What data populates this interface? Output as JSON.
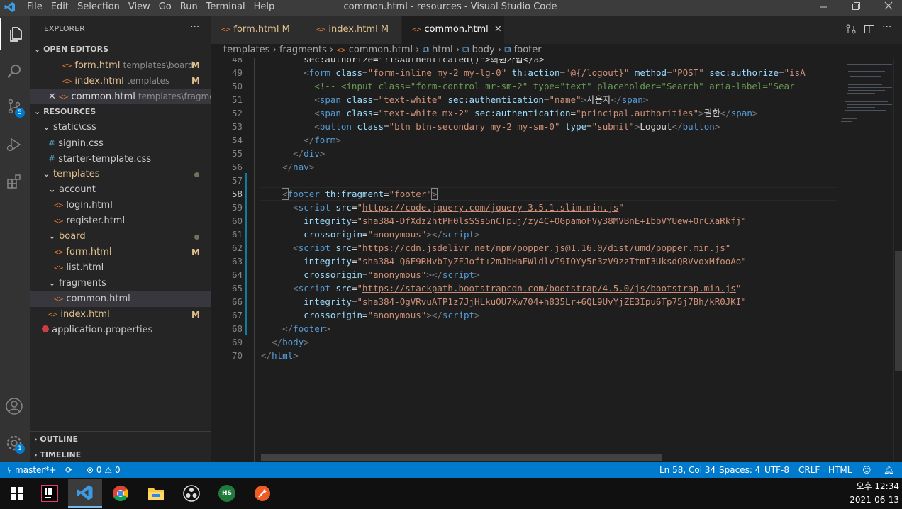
{
  "window": {
    "title": "common.html - resources - Visual Studio Code",
    "menu": [
      "File",
      "Edit",
      "Selection",
      "View",
      "Go",
      "Run",
      "Terminal",
      "Help"
    ]
  },
  "activity": {
    "scm_badge": "5",
    "settings_badge": "1"
  },
  "sidebar": {
    "title": "EXPLORER",
    "open_editors_header": "OPEN EDITORS",
    "open_editors": [
      {
        "name": "form.html",
        "path": "templates\\board",
        "status": "M"
      },
      {
        "name": "index.html",
        "path": "templates",
        "status": "M"
      },
      {
        "name": "common.html",
        "path": "templates\\fragme...",
        "status": ""
      }
    ],
    "resources_header": "RESOURCES",
    "tree": {
      "static_css": "static\\css",
      "signin": "signin.css",
      "starter": "starter-template.css",
      "templates": "templates",
      "account": "account",
      "login": "login.html",
      "register": "register.html",
      "board": "board",
      "form": "form.html",
      "form_status": "M",
      "list": "list.html",
      "fragments": "fragments",
      "common": "common.html",
      "index": "index.html",
      "index_status": "M",
      "app_props": "application.properties"
    },
    "outline": "OUTLINE",
    "timeline": "TIMELINE"
  },
  "tabs": [
    {
      "label": "form.html",
      "status": "M"
    },
    {
      "label": "index.html",
      "status": "M"
    },
    {
      "label": "common.html",
      "status": ""
    }
  ],
  "breadcrumb": [
    "templates",
    "fragments",
    "common.html",
    "html",
    "body",
    "footer"
  ],
  "editor": {
    "line_numbers": [
      "48",
      "49",
      "50",
      "51",
      "52",
      "53",
      "54",
      "55",
      "56",
      "57",
      "58",
      "59",
      "60",
      "61",
      "62",
      "63",
      "64",
      "65",
      "66",
      "67",
      "68",
      "69",
      "70"
    ],
    "line48": "        sec:authorize=\"!isAuthenticated()\">회원가입</a>",
    "l49": {
      "ind": "        ",
      "attr1": "class",
      "val1": "\"form-inline my-2 my-lg-0\"",
      "attr2": "th:action",
      "val2": "\"@{/logout}\"",
      "attr3": "method",
      "val3": "\"POST\"",
      "attr4": "sec:authorize",
      "val4": "\"isA"
    },
    "l50": "          <!-- <input class=\"form-control mr-sm-2\" type=\"text\" placeholder=\"Search\" aria-label=\"Sear",
    "l51": {
      "ind": "          ",
      "attr1": "class",
      "val1": "\"text-white\"",
      "attr2": "sec:authentication",
      "val2": "\"name\"",
      "text": "사용자"
    },
    "l52": {
      "ind": "          ",
      "attr1": "class",
      "val1": "\"text-white mx-2\"",
      "attr2": "sec:authentication",
      "val2": "\"principal.authorities\"",
      "text": "권한"
    },
    "l53": {
      "ind": "          ",
      "attr1": "class",
      "val1": "\"btn btn-secondary my-2 my-sm-0\"",
      "attr2": "type",
      "val2": "\"submit\"",
      "text": "Logout"
    },
    "l58": {
      "attr": "th:fragment",
      "val": "\"footer\""
    },
    "l59_src": "https://code.jquery.com/jquery-3.5.1.slim.min.js",
    "l60_int": "\"sha384-DfXdz2htPH0lsSSs5nCTpuj/zy4C+OGpamoFVy38MVBnE+IbbVYUew+OrCXaRkfj\"",
    "l62_src": "https://cdn.jsdelivr.net/npm/popper.js@1.16.0/dist/umd/popper.min.js",
    "l63_int": "\"sha384-Q6E9RHvbIyZFJoft+2mJbHaEWldlvI9IOYy5n3zV9zzTtmI3UksdQRVvoxMfooAo\"",
    "l65_src": "https://stackpath.bootstrapcdn.com/bootstrap/4.5.0/js/bootstrap.min.js",
    "l66_int": "\"sha384-OgVRvuATP1z7JjHLkuOU7Xw704+h835Lr+6QL9UvYjZE3Ipu6Tp75j7Bh/kR0JKI\"",
    "crossorigin_attr": "crossorigin",
    "anon": "\"anonymous\"",
    "integrity_attr": "integrity",
    "src_attr": "src"
  },
  "status": {
    "branch": "master*+",
    "errors": "0",
    "warnings": "0",
    "position": "Ln 58, Col 34",
    "spaces": "Spaces: 4",
    "encoding": "UTF-8",
    "eol": "CRLF",
    "language": "HTML"
  },
  "taskbar": {
    "time": "오후 12:34",
    "date": "2021-06-13",
    "hs": "HS"
  },
  "colors": {
    "accent": "#007acc",
    "titlebar": "#3c3c3c",
    "modified": "#e2c08d"
  }
}
